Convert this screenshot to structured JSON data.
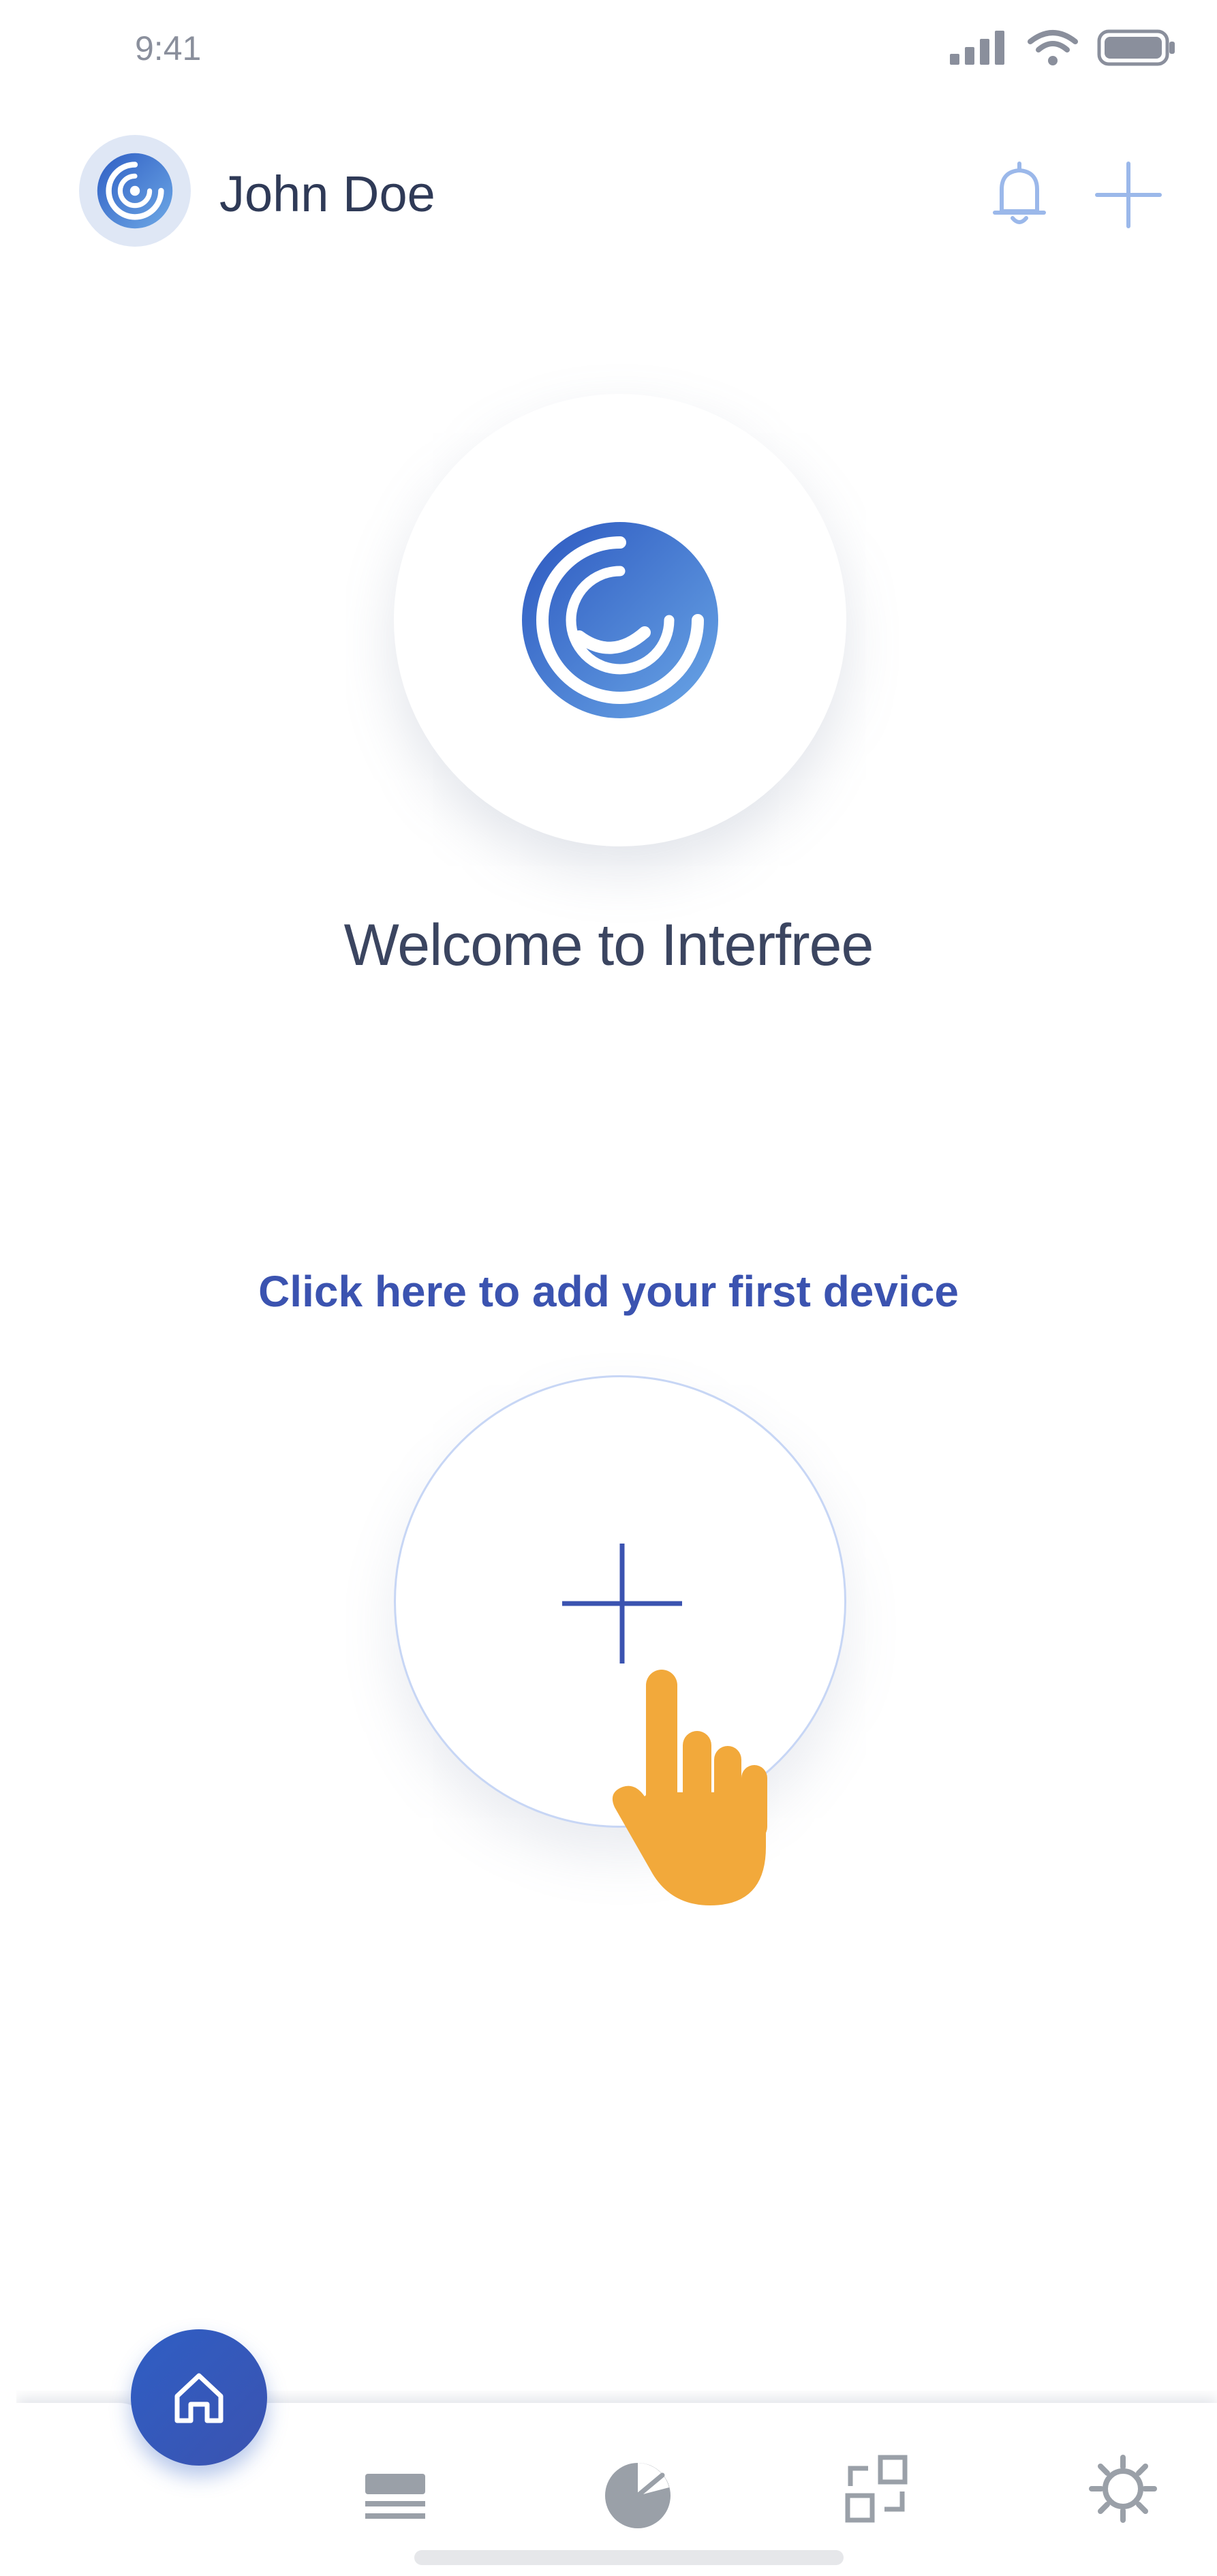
{
  "status_bar": {
    "time": "9:41",
    "icons": [
      "signal-icon",
      "wifi-icon",
      "battery-icon"
    ]
  },
  "header": {
    "user_name": "John Doe",
    "avatar_icon": "swirl-logo-icon",
    "actions": [
      "bell-icon",
      "plus-icon"
    ]
  },
  "welcome": {
    "logo_icon": "swirl-logo-icon",
    "title": "Welcome to Interfree"
  },
  "add_device": {
    "prompt": "Click here to add your first device",
    "button_icon": "plus-icon",
    "hint_icon": "pointing-hand-icon"
  },
  "bottom_nav": {
    "active": "home",
    "items": [
      {
        "id": "home",
        "icon": "home-icon"
      },
      {
        "id": "devices",
        "icon": "stack-icon"
      },
      {
        "id": "gauge",
        "icon": "gauge-icon"
      },
      {
        "id": "scenes",
        "icon": "grid-transfer-icon"
      },
      {
        "id": "settings",
        "icon": "gear-icon"
      }
    ]
  },
  "colors": {
    "brand_blue": "#3b53b0",
    "brand_gradient_start": "#2f5ec4",
    "brand_gradient_end": "#6ea9e6",
    "text_dark": "#2f3a57",
    "icon_light_blue": "#9bb8ea",
    "hand_orange": "#f2a93b",
    "nav_icon_gray": "#9aa0a8"
  }
}
